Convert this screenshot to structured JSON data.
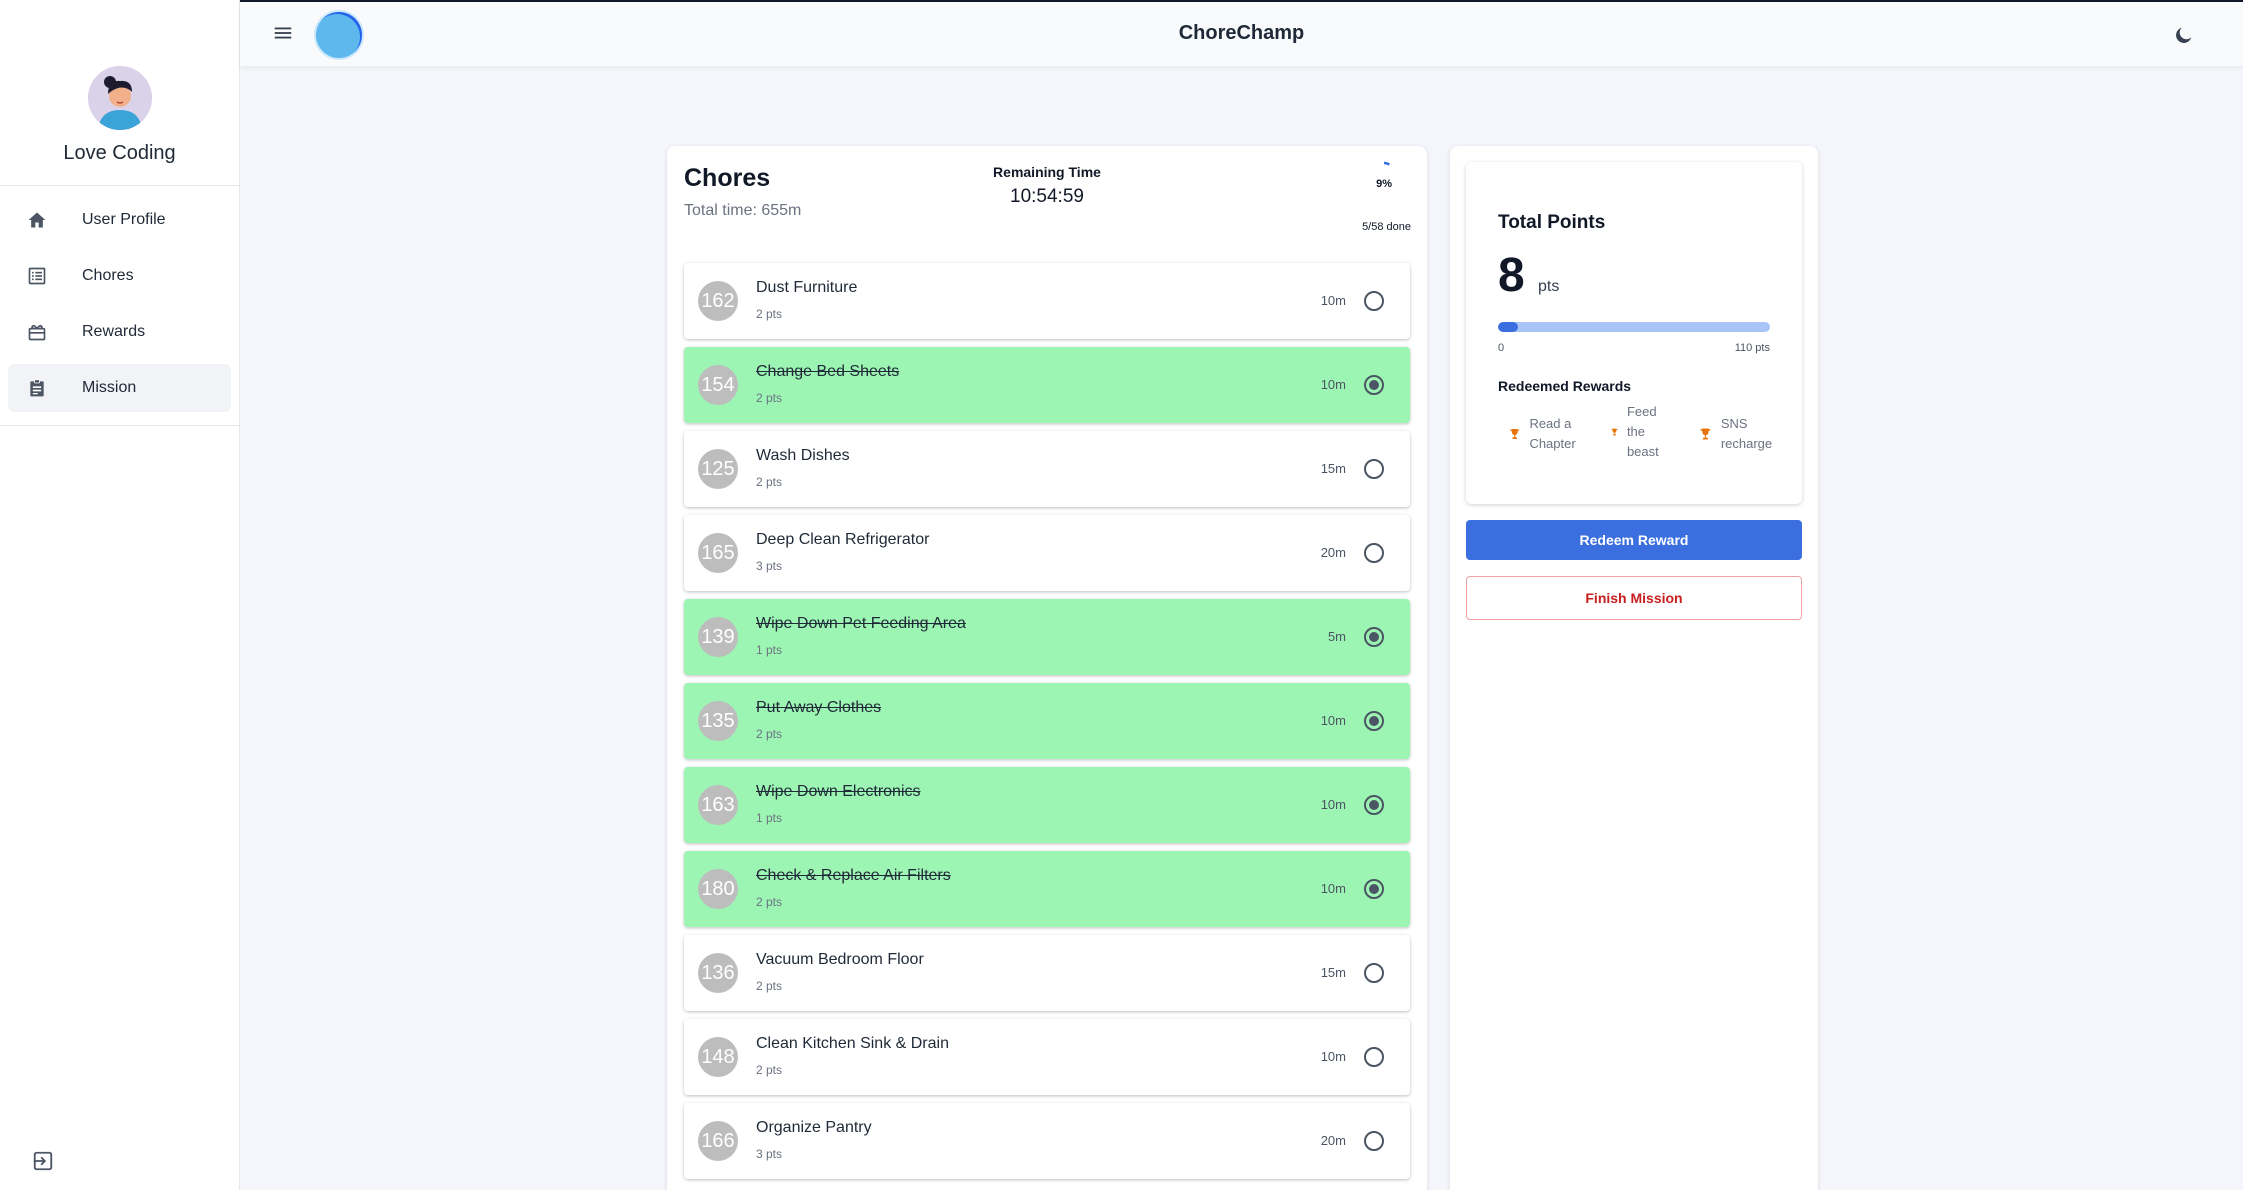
{
  "app": {
    "title": "ChoreChamp"
  },
  "user": {
    "name": "Love Coding"
  },
  "sidebar": {
    "items": [
      {
        "label": "User Profile",
        "icon": "home-icon",
        "active": false
      },
      {
        "label": "Chores",
        "icon": "list-icon",
        "active": false
      },
      {
        "label": "Rewards",
        "icon": "gift-icon",
        "active": false
      },
      {
        "label": "Mission",
        "icon": "clipboard-icon",
        "active": true
      }
    ]
  },
  "chores": {
    "title": "Chores",
    "total_time": "Total time: 655m",
    "remaining_label": "Remaining Time",
    "remaining_value": "10:54:59",
    "progress_pct": "9%",
    "progress_fraction": 0.09,
    "done_count": "5/58 done",
    "items": [
      {
        "id": "162",
        "name": "Dust Furniture",
        "pts": "2 pts",
        "time": "10m",
        "done": false
      },
      {
        "id": "154",
        "name": "Change Bed Sheets",
        "pts": "2 pts",
        "time": "10m",
        "done": true
      },
      {
        "id": "125",
        "name": "Wash Dishes",
        "pts": "2 pts",
        "time": "15m",
        "done": false
      },
      {
        "id": "165",
        "name": "Deep Clean Refrigerator",
        "pts": "3 pts",
        "time": "20m",
        "done": false
      },
      {
        "id": "139",
        "name": "Wipe Down Pet Feeding Area",
        "pts": "1 pts",
        "time": "5m",
        "done": true
      },
      {
        "id": "135",
        "name": "Put Away Clothes",
        "pts": "2 pts",
        "time": "10m",
        "done": true
      },
      {
        "id": "163",
        "name": "Wipe Down Electronics",
        "pts": "1 pts",
        "time": "10m",
        "done": true
      },
      {
        "id": "180",
        "name": "Check & Replace Air Filters",
        "pts": "2 pts",
        "time": "10m",
        "done": true
      },
      {
        "id": "136",
        "name": "Vacuum Bedroom Floor",
        "pts": "2 pts",
        "time": "15m",
        "done": false
      },
      {
        "id": "148",
        "name": "Clean Kitchen Sink & Drain",
        "pts": "2 pts",
        "time": "10m",
        "done": false
      },
      {
        "id": "166",
        "name": "Organize Pantry",
        "pts": "3 pts",
        "time": "20m",
        "done": false
      }
    ]
  },
  "points": {
    "title": "Total Points",
    "value": "8",
    "unit": "pts",
    "bar_fraction": 0.073,
    "bar_min": "0",
    "bar_max": "110 pts",
    "redeemed_title": "Redeemed Rewards",
    "rewards": [
      {
        "label": "Read a Chapter",
        "icon": "trophy-icon"
      },
      {
        "label": "Feed the beast",
        "icon": "trophy-icon"
      },
      {
        "label": "SNS recharge",
        "icon": "trophy-icon"
      }
    ]
  },
  "actions": {
    "redeem": "Redeem Reward",
    "finish": "Finish Mission"
  },
  "colors": {
    "accent": "#3b6fe0",
    "done_bg": "#9df5b4",
    "danger": "#c81e1e",
    "trophy": "#e8740c"
  }
}
